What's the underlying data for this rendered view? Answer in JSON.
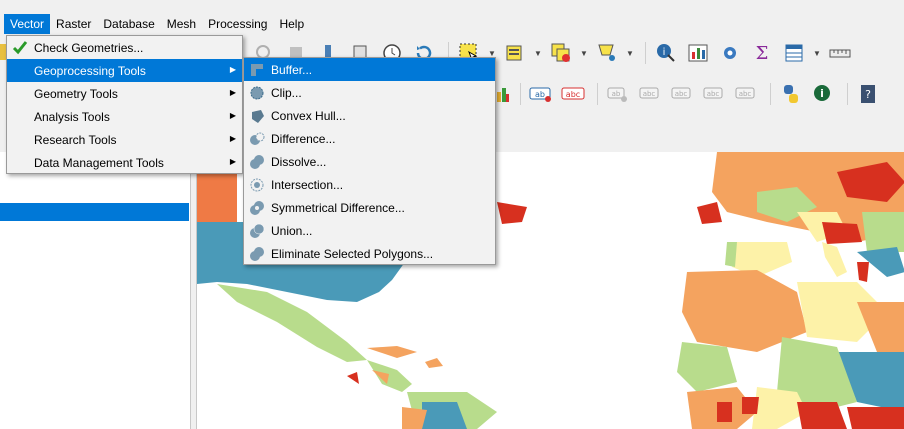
{
  "menubar": {
    "items": [
      {
        "label": "Vector",
        "active": true
      },
      {
        "label": "Raster"
      },
      {
        "label": "Database"
      },
      {
        "label": "Mesh"
      },
      {
        "label": "Processing"
      },
      {
        "label": "Help"
      }
    ]
  },
  "vector_menu": {
    "items": [
      {
        "label": "Check Geometries...",
        "icon": "check-geometries-icon"
      },
      {
        "label": "Geoprocessing Tools",
        "submenu": true,
        "highlighted": true
      },
      {
        "label": "Geometry Tools",
        "submenu": true
      },
      {
        "label": "Analysis Tools",
        "submenu": true
      },
      {
        "label": "Research Tools",
        "submenu": true
      },
      {
        "label": "Data Management Tools",
        "submenu": true
      }
    ]
  },
  "geoprocessing_menu": {
    "items": [
      {
        "label": "Buffer...",
        "icon": "buffer-icon",
        "highlighted": true
      },
      {
        "label": "Clip...",
        "icon": "clip-icon"
      },
      {
        "label": "Convex Hull...",
        "icon": "convex-hull-icon"
      },
      {
        "label": "Difference...",
        "icon": "difference-icon"
      },
      {
        "label": "Dissolve...",
        "icon": "dissolve-icon"
      },
      {
        "label": "Intersection...",
        "icon": "intersection-icon"
      },
      {
        "label": "Symmetrical Difference...",
        "icon": "symmetrical-difference-icon"
      },
      {
        "label": "Union...",
        "icon": "union-icon"
      },
      {
        "label": "Eliminate Selected Polygons...",
        "icon": "eliminate-polygons-icon"
      }
    ]
  },
  "colors": {
    "accent": "#0078d7",
    "map_blue": "#4a9ab8",
    "map_orange": "#f4a35f",
    "map_red": "#d7301f",
    "map_lightgreen": "#b8dc8c",
    "map_yellow": "#fdf2a8"
  }
}
